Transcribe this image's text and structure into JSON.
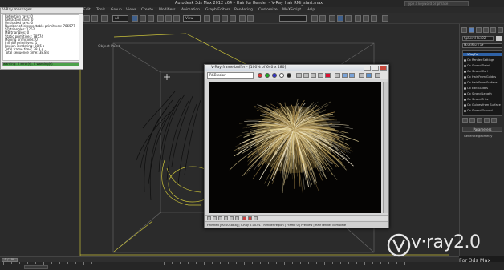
{
  "app": {
    "window_title": "Autodesk 3ds Max 2012 x64  –  Hair for Render  –  V-Ray Hair RMi_start.max",
    "search_placeholder": "Type a keyword or phrase",
    "menu": [
      "Edit",
      "Tools",
      "Group",
      "Views",
      "Create",
      "Modifiers",
      "Animation",
      "Graph Editors",
      "Rendering",
      "Customize",
      "MAXScript",
      "Help"
    ],
    "toolbar": {
      "selection_filter": "All",
      "reference_coord": "View"
    }
  },
  "viewport": {
    "label": "Object Paint"
  },
  "info_panel": {
    "title": "V-Ray messages",
    "lines": [
      "Reflection rays: 0",
      "Refraction rays: 0",
      "Unshaded rays: 0",
      "Number of intersectable primitives: 786577",
      "SD triangles: 1752",
      "MB triangles: 0",
      "Static primitives: 78574",
      "Moving primitives: 0",
      "Infinite primitives: 1",
      "Region rendering: 38.5 s",
      "Total frame time: 38.8 s",
      "Total sequence time: 38.8 s"
    ],
    "status_line": "warning: 0 error(s), 0 warning(s)",
    "progress": 1.0
  },
  "vfb": {
    "title": "V-Ray frame buffer - [100% of 640 x 480]",
    "channel": "RGB color",
    "status_text": "Finished  [00:00:38.8]   |   V-Ray 2.00.01   |   Render region   |   Frame 0   |   Preview   |   Hair render complete"
  },
  "command_panel": {
    "object_name": "SphereHair02",
    "modifier_list": "Modifier List",
    "stack": [
      "VRayFur",
      "Ox Render Settings",
      "Ox Strand Detail",
      "Ox Strand Curl",
      "Ox Hair From Guides",
      "Ox Hair From Surface",
      "Ox Edit Guides",
      "Ox Strand Length",
      "Ox Strand Frizz",
      "Ox Guides from Surface",
      "Ox Strand Ground"
    ],
    "selected_index": 0,
    "rollout": "Parameters",
    "param_label": "Generate geometry"
  },
  "timeline": {
    "slider_label": "0 / 100"
  },
  "watermark": {
    "brand": "v·ray2.0",
    "tagline": "For 3ds Max"
  },
  "colors": {
    "accent": "#2f62a6",
    "viewport_bg": "#2b2b2b",
    "hair": "#c8b06a",
    "progress": "#4ca14b"
  }
}
